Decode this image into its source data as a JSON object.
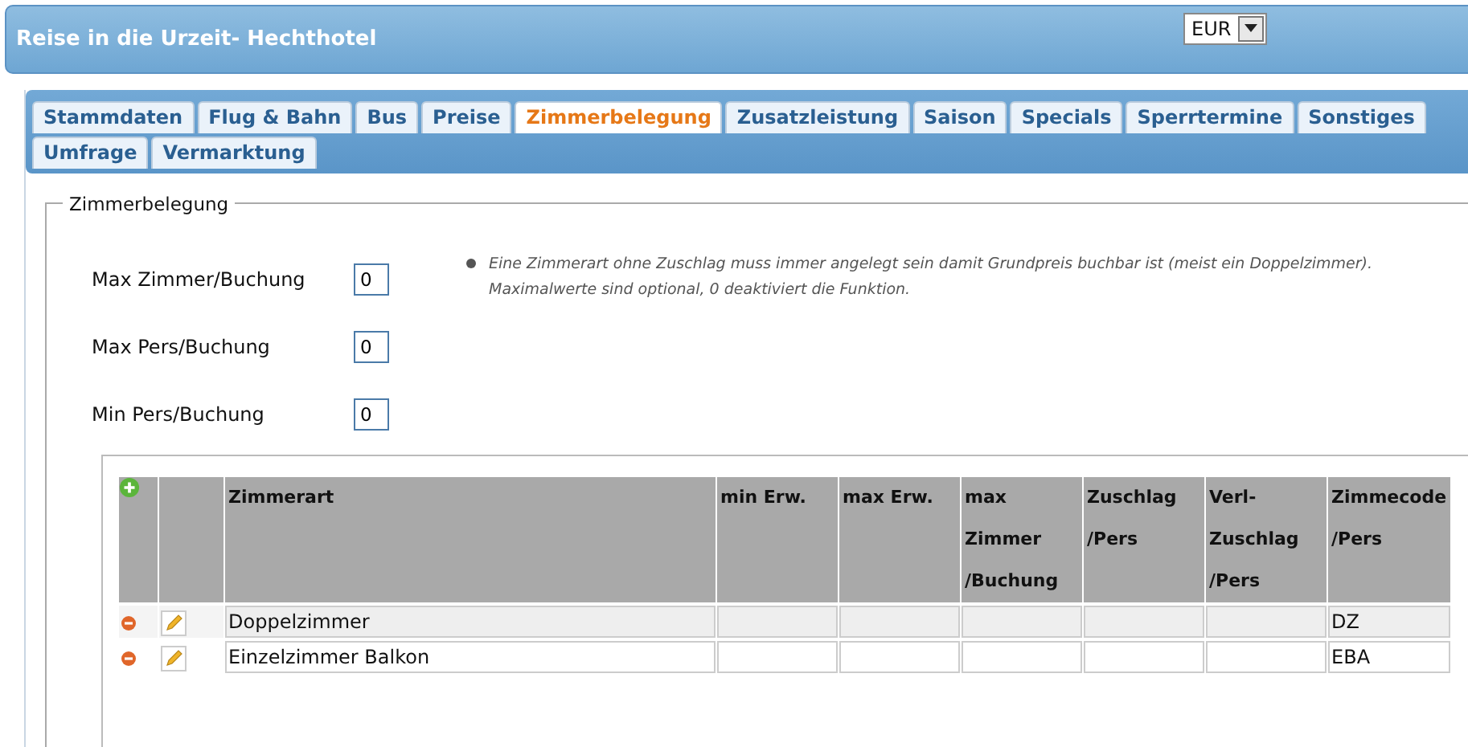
{
  "header": {
    "title": "Reise in die Urzeit- Hechthotel",
    "currency": "EUR"
  },
  "tabs": [
    {
      "label": "Stammdaten",
      "selected": false
    },
    {
      "label": "Flug & Bahn",
      "selected": false
    },
    {
      "label": "Bus",
      "selected": false
    },
    {
      "label": "Preise",
      "selected": false
    },
    {
      "label": "Zimmerbelegung",
      "selected": true
    },
    {
      "label": "Zusatzleistung",
      "selected": false
    },
    {
      "label": "Saison",
      "selected": false
    },
    {
      "label": "Specials",
      "selected": false
    },
    {
      "label": "Sperrtermine",
      "selected": false
    },
    {
      "label": "Sonstiges",
      "selected": false
    },
    {
      "label": "Umfrage",
      "selected": false
    },
    {
      "label": "Vermarktung",
      "selected": false
    }
  ],
  "section": {
    "legend": "Zimmerbelegung",
    "fields": [
      {
        "label": "Max Zimmer/Buchung",
        "value": "0"
      },
      {
        "label": "Max Pers/Buchung",
        "value": "0"
      },
      {
        "label": "Min Pers/Buchung",
        "value": "0"
      }
    ],
    "note": "Eine Zimmerart ohne Zuschlag muss immer angelegt sein damit Grundpreis buchbar ist (meist ein Doppelzimmer).\nMaximalwerte sind optional, 0 deaktiviert die Funktion.",
    "table": {
      "columns": [
        "Zimmerart",
        "min Erw.",
        "max Erw.",
        "max\nZimmer\n/Buchung",
        "Zuschlag\n/Pers",
        "Verl-\nZuschlag\n/Pers",
        "Zimmecode\n/Pers"
      ],
      "rows": [
        {
          "cells": [
            "Doppelzimmer",
            "",
            "",
            "",
            "",
            "",
            "DZ"
          ]
        },
        {
          "cells": [
            "Einzelzimmer Balkon",
            "",
            "",
            "",
            "",
            "",
            "EBA"
          ]
        }
      ]
    }
  }
}
